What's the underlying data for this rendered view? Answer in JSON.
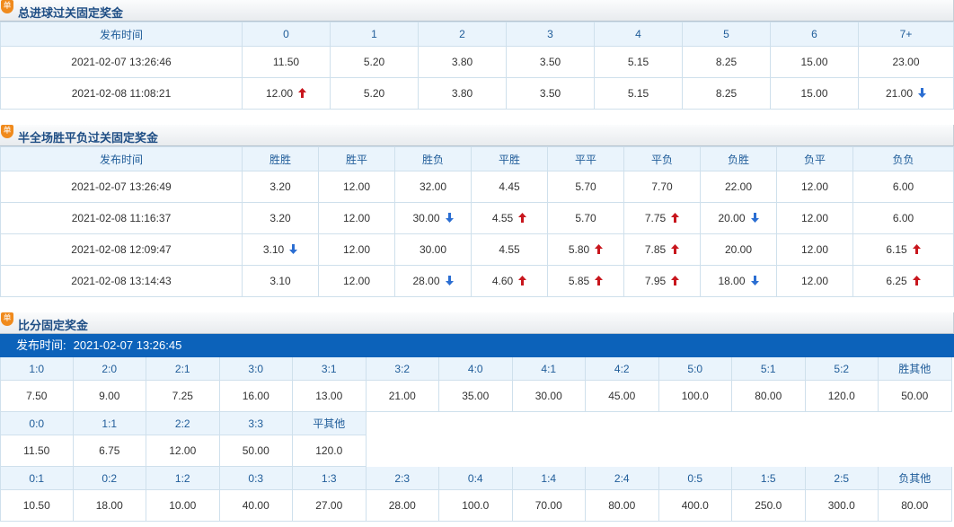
{
  "colors": {
    "up": "#c8161d",
    "down": "#2b6ed2",
    "accent": "#0c62ba",
    "badge": "#f08a1c"
  },
  "icons": {
    "badge": "badge-icon",
    "up": "arrow-up-icon",
    "down": "arrow-down-icon"
  },
  "s1": {
    "badge": "单",
    "title": "总进球过关固定奖金",
    "headers": [
      "发布时间",
      "0",
      "1",
      "2",
      "3",
      "4",
      "5",
      "6",
      "7+"
    ],
    "rows": [
      {
        "cells": [
          "2021-02-07 13:26:46",
          "11.50",
          "5.20",
          "3.80",
          "3.50",
          "5.15",
          "8.25",
          "15.00",
          "23.00"
        ],
        "arrows": [
          "",
          "",
          "",
          "",
          "",
          "",
          "",
          "",
          ""
        ]
      },
      {
        "cells": [
          "2021-02-08 11:08:21",
          "12.00",
          "5.20",
          "3.80",
          "3.50",
          "5.15",
          "8.25",
          "15.00",
          "21.00"
        ],
        "arrows": [
          "",
          "up",
          "",
          "",
          "",
          "",
          "",
          "",
          "down"
        ]
      }
    ]
  },
  "s2": {
    "badge": "单",
    "title": "半全场胜平负过关固定奖金",
    "headers": [
      "发布时间",
      "胜胜",
      "胜平",
      "胜负",
      "平胜",
      "平平",
      "平负",
      "负胜",
      "负平",
      "负负"
    ],
    "rows": [
      {
        "cells": [
          "2021-02-07 13:26:49",
          "3.20",
          "12.00",
          "32.00",
          "4.45",
          "5.70",
          "7.70",
          "22.00",
          "12.00",
          "6.00"
        ],
        "arrows": [
          "",
          "",
          "",
          "",
          "",
          "",
          "",
          "",
          "",
          ""
        ]
      },
      {
        "cells": [
          "2021-02-08 11:16:37",
          "3.20",
          "12.00",
          "30.00",
          "4.55",
          "5.70",
          "7.75",
          "20.00",
          "12.00",
          "6.00"
        ],
        "arrows": [
          "",
          "",
          "",
          "down",
          "up",
          "",
          "up",
          "down",
          "",
          ""
        ]
      },
      {
        "cells": [
          "2021-02-08 12:09:47",
          "3.10",
          "12.00",
          "30.00",
          "4.55",
          "5.80",
          "7.85",
          "20.00",
          "12.00",
          "6.15"
        ],
        "arrows": [
          "",
          "down",
          "",
          "",
          "",
          "up",
          "up",
          "",
          "",
          "up"
        ]
      },
      {
        "cells": [
          "2021-02-08 13:14:43",
          "3.10",
          "12.00",
          "28.00",
          "4.60",
          "5.85",
          "7.95",
          "18.00",
          "12.00",
          "6.25"
        ],
        "arrows": [
          "",
          "",
          "",
          "down",
          "up",
          "up",
          "up",
          "down",
          "",
          "up"
        ]
      }
    ]
  },
  "s3": {
    "badge": "单",
    "title": "比分固定奖金",
    "publish_label": "发布时间:",
    "publish_time": "2021-02-07 13:26:45",
    "win": {
      "labels": [
        "1:0",
        "2:0",
        "2:1",
        "3:0",
        "3:1",
        "3:2",
        "4:0",
        "4:1",
        "4:2",
        "5:0",
        "5:1",
        "5:2",
        "胜其他"
      ],
      "values": [
        "7.50",
        "9.00",
        "7.25",
        "16.00",
        "13.00",
        "21.00",
        "35.00",
        "30.00",
        "45.00",
        "100.0",
        "80.00",
        "120.0",
        "50.00"
      ]
    },
    "draw": {
      "labels": [
        "0:0",
        "1:1",
        "2:2",
        "3:3",
        "平其他"
      ],
      "values": [
        "11.50",
        "6.75",
        "12.00",
        "50.00",
        "120.0"
      ]
    },
    "lose": {
      "labels": [
        "0:1",
        "0:2",
        "1:2",
        "0:3",
        "1:3",
        "2:3",
        "0:4",
        "1:4",
        "2:4",
        "0:5",
        "1:5",
        "2:5",
        "负其他"
      ],
      "values": [
        "10.50",
        "18.00",
        "10.00",
        "40.00",
        "27.00",
        "28.00",
        "100.0",
        "70.00",
        "80.00",
        "400.0",
        "250.0",
        "300.0",
        "80.00"
      ]
    }
  }
}
